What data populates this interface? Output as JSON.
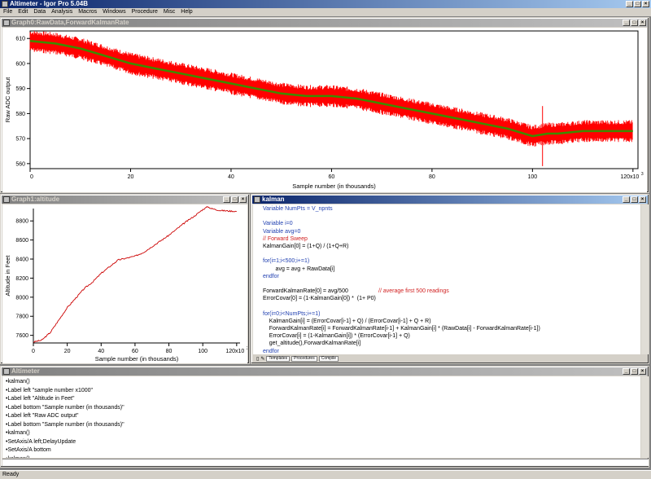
{
  "app": {
    "title": "Altimeter - Igor Pro 5.04B"
  },
  "menu": [
    "File",
    "Edit",
    "Data",
    "Analysis",
    "Macros",
    "Windows",
    "Procedure",
    "Misc",
    "Help"
  ],
  "graph0": {
    "title": "Graph0:RawData,ForwardKalmanRate",
    "ylabel": "Raw ADC output",
    "xlabel": "Sample number (in thousands)",
    "yticks": [
      "610",
      "600",
      "590",
      "580",
      "570",
      "560"
    ],
    "xticks": [
      "0",
      "20",
      "40",
      "60",
      "80",
      "100",
      "120x10"
    ],
    "x_exp": "3",
    "colors": {
      "raw": "#ff0000",
      "filtered": "#3c8c00"
    }
  },
  "graph1": {
    "title": "Graph1:altitude",
    "ylabel": "Altitude in Feet",
    "xlabel": "Sample number (in thousands)",
    "yticks": [
      "8800",
      "8600",
      "8400",
      "8200",
      "8000",
      "7800",
      "7600"
    ],
    "xticks": [
      "0",
      "20",
      "40",
      "60",
      "80",
      "100",
      "120x10"
    ],
    "x_exp": "3",
    "color": "#cc0000"
  },
  "chart_data": [
    {
      "type": "line",
      "xlabel": "Sample number (in thousands)",
      "ylabel": "Raw ADC output",
      "xlim": [
        0,
        121
      ],
      "ylim": [
        558,
        613
      ],
      "series": [
        {
          "x": [
            0,
            5,
            10,
            15,
            20,
            25,
            30,
            35,
            40,
            45,
            50,
            55,
            60,
            65,
            70,
            75,
            80,
            85,
            90,
            95,
            100,
            103,
            105,
            110,
            115,
            120
          ],
          "values": [
            609,
            608,
            606,
            603,
            600,
            598,
            596,
            594,
            592,
            590,
            588,
            587,
            587,
            586,
            584,
            582,
            580,
            578,
            576,
            574,
            571,
            572,
            572,
            573,
            573,
            573
          ]
        }
      ]
    },
    {
      "type": "line",
      "xlabel": "Sample number (in thousands)",
      "ylabel": "Altitude in Feet",
      "xlim": [
        0,
        122
      ],
      "ylim": [
        7520,
        8930
      ],
      "series": [
        {
          "x": [
            0,
            5,
            10,
            15,
            20,
            25,
            30,
            35,
            40,
            45,
            50,
            55,
            60,
            65,
            70,
            75,
            80,
            85,
            90,
            95,
            100,
            103,
            105,
            110,
            115,
            120
          ],
          "values": [
            7530,
            7550,
            7630,
            7760,
            7890,
            7990,
            8090,
            8160,
            8250,
            8320,
            8390,
            8410,
            8430,
            8470,
            8530,
            8590,
            8650,
            8720,
            8790,
            8850,
            8920,
            8950,
            8930,
            8910,
            8905,
            8900
          ]
        }
      ]
    }
  ],
  "kalman": {
    "title": "kalman",
    "toolbar": [
      "Templates",
      "Procedures",
      "Compile"
    ],
    "lines": [
      {
        "t": "Variable NumPts = V_npnts",
        "c": "kw"
      },
      {
        "t": "",
        "c": ""
      },
      {
        "t": "Variable i=0",
        "c": "kw"
      },
      {
        "t": "Variable avg=0",
        "c": "kw"
      },
      {
        "t": "// Forward Sweep",
        "c": "cm"
      },
      {
        "t": "KalmanGain[0] = (1+Q) / (1+Q+R)",
        "c": ""
      },
      {
        "t": "",
        "c": ""
      },
      {
        "t": "for(i=1;i<500;i+=1)",
        "c": "kw"
      },
      {
        "t": "        avg = avg + RawData[i]",
        "c": ""
      },
      {
        "t": "endfor",
        "c": "kw"
      },
      {
        "t": "",
        "c": ""
      },
      {
        "t": "ForwardKalmanRate[0] = avg/500",
        "c": ""
      },
      {
        "t": "ErrorCovar[0] = (1-KalmanGain[0]) *  (1+ P0)",
        "c": ""
      },
      {
        "t": "",
        "c": ""
      },
      {
        "t": "for(i=0;i<NumPts;i+=1)",
        "c": "kw"
      },
      {
        "t": "    KalmanGain[i] = (ErrorCovar[i-1] + Q) / (ErrorCovar[i-1] + Q + R)",
        "c": ""
      },
      {
        "t": "    ForwardKalmanRate[i] = ForwardKalmanRate[i-1] + KalmanGain[i] * (RawData[i] - ForwardKalmanRate[i-1])",
        "c": ""
      },
      {
        "t": "    ErrorCovar[i] = (1-KalmanGain[i]) * (ErrorCovar[i-1] + Q)",
        "c": ""
      },
      {
        "t": "    get_altitude(),ForwardKalmanRate[i]",
        "c": ""
      },
      {
        "t": "endfor",
        "c": "kw"
      },
      {
        "t": "",
        "c": ""
      },
      {
        "t": "End",
        "c": "kw"
      }
    ],
    "comment": "// average first 500 readings"
  },
  "history": {
    "title": "Altimeter",
    "lines": [
      "•kalman()",
      "•Label left \"sample number x1000\"",
      "•Label left \"Altitude in Feet\"",
      "•Label bottom \"Sample number (in thousands)\"",
      "•Label left \"Raw ADC output\"",
      "•Label bottom \"Sample number (in thousands)\"",
      "•kalman()",
      "•SetAxis/A left;DelayUpdate",
      "•SetAxis/A bottom",
      "•kalman()",
      "•SetAxis/A left;DelayUpdate",
      "•SetAxis/A bottom"
    ]
  },
  "status": "Ready"
}
